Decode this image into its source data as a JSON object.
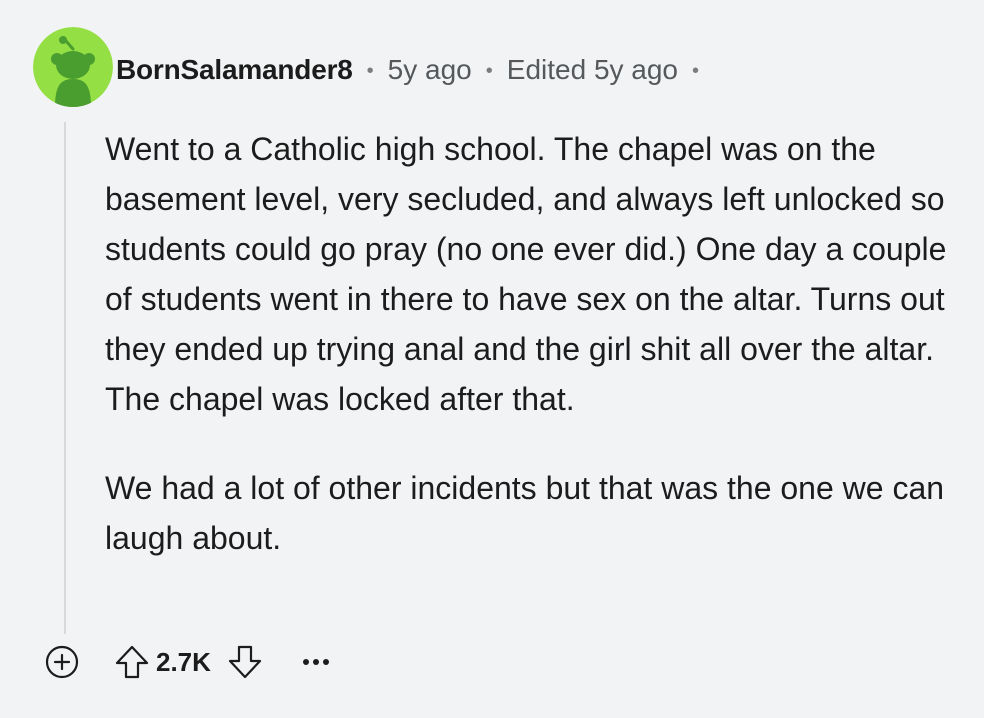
{
  "comment": {
    "author": "BornSalamander8",
    "age": "5y ago",
    "edited": "Edited 5y ago",
    "paragraphs": [
      "Went to a Catholic high school. The chapel was on the basement level, very secluded, and always left unlocked so students could go pray (no one ever did.) One day a couple of students went in there to have sex on the altar. Turns out they ended up trying anal and the girl shit all over the altar. The chapel was locked after that.",
      "We had a lot of other incidents but that was the one we can laugh about."
    ],
    "score": "2.7K",
    "separator": "•"
  },
  "icons": {
    "avatar": "snoo-avatar-icon",
    "expand": "plus-circle-icon",
    "upvote": "arrow-up-icon",
    "downvote": "arrow-down-icon",
    "more": "ellipsis-icon"
  },
  "colors": {
    "background": "#f2f3f5",
    "avatar_bg": "#94e044",
    "avatar_snoo": "#4a9d2f",
    "text": "#1c1c1c",
    "meta": "#55595c",
    "thread_line": "#d6dadc"
  }
}
